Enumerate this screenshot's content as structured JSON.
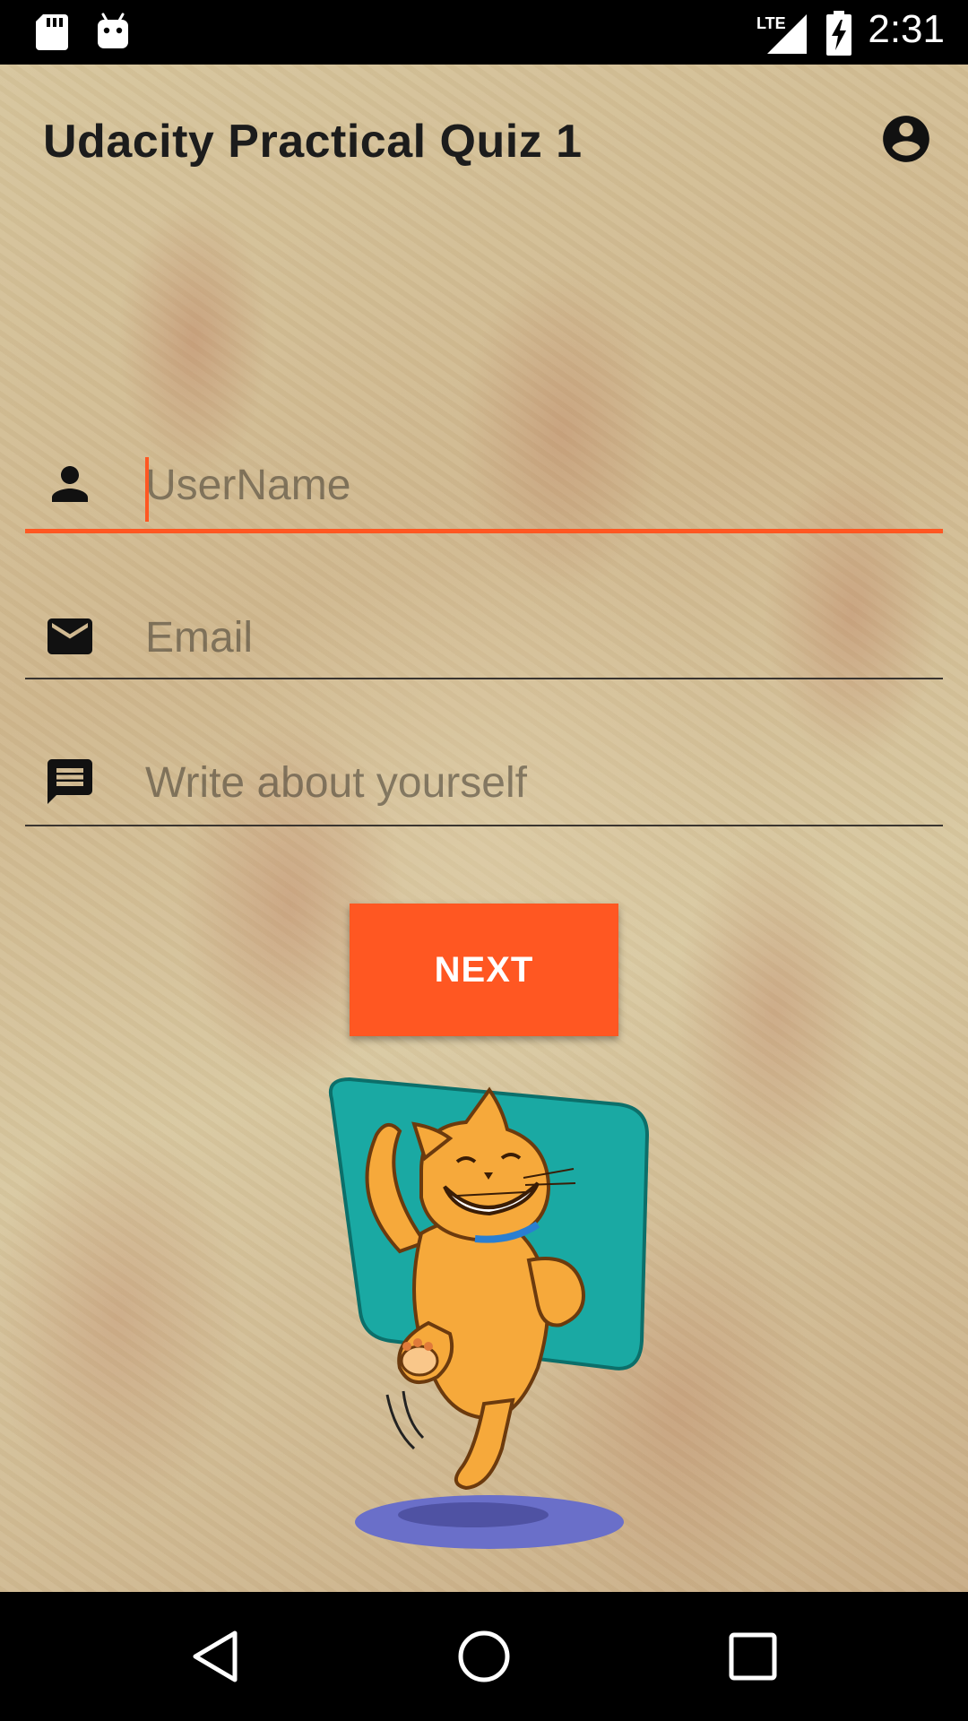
{
  "status_bar": {
    "time": "2:31",
    "network_label": "LTE",
    "icons": [
      "sd-card-icon",
      "android-icon",
      "lte-signal-icon",
      "battery-charging-icon"
    ]
  },
  "app_bar": {
    "title": "Udacity Practical Quiz 1",
    "account_icon": "account-circle-icon"
  },
  "form": {
    "username": {
      "placeholder": "UserName",
      "value": "",
      "icon": "person-icon",
      "focused": true
    },
    "email": {
      "placeholder": "Email",
      "value": "",
      "icon": "email-icon"
    },
    "about": {
      "placeholder": "Write about yourself",
      "value": "",
      "icon": "message-icon"
    },
    "next_label": "NEXT"
  },
  "illustration": {
    "name": "dancing-cat-illustration"
  },
  "nav_bar": {
    "buttons": [
      "back",
      "home",
      "recents"
    ]
  },
  "colors": {
    "accent": "#ff5722",
    "status_bar": "#000000",
    "nav_bar": "#000000",
    "title_text": "#1c1c1c",
    "cat_background": "#1aa9a3",
    "cat_body": "#f6a93b",
    "cat_shadow_pad": "#6a6fc9"
  }
}
